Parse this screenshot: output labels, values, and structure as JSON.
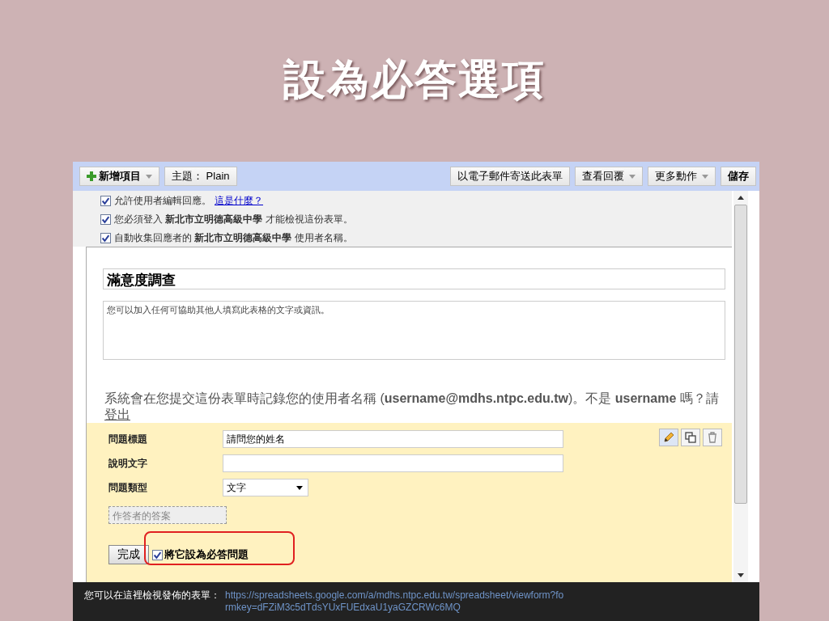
{
  "slide_title": "設為必答選項",
  "toolbar": {
    "left": [
      {
        "label": "新增項目",
        "kind": "add",
        "dropdown": true
      },
      {
        "label": "主題： Plain",
        "kind": "plain",
        "dropdown": false
      }
    ],
    "right": [
      {
        "label": "以電子郵件寄送此表單",
        "kind": "plain",
        "dropdown": false
      },
      {
        "label": "查看回覆",
        "kind": "plain",
        "dropdown": true
      },
      {
        "label": "更多動作",
        "kind": "plain",
        "dropdown": true
      },
      {
        "label": "儲存",
        "kind": "bold",
        "dropdown": false
      }
    ]
  },
  "settings": [
    {
      "checked": true,
      "text": "允許使用者編輯回應。",
      "link": "這是什麼？"
    },
    {
      "checked": true,
      "text": "您必須登入 **新北市立明德高級中學** 才能檢視這份表單。"
    },
    {
      "checked": true,
      "text": "自動收集回應者的 **新北市立明德高級中學** 使用者名稱。"
    }
  ],
  "form": {
    "title": "滿意度調查",
    "description": "您可以加入任何可協助其他人填寫此表格的文字或資訊。",
    "notice": "系統會在您提交這份表單時記錄您的使用者名稱 (**username@mdhs.ntpc.edu.tw**)。不是 **username** 嗎？請",
    "notice_link": "登出"
  },
  "question": {
    "fields": [
      {
        "label": "問題標題",
        "value": "請問您的姓名"
      },
      {
        "label": "說明文字"
      }
    ],
    "type_label": "問題類型",
    "type_value": "文字",
    "answer_placeholder": "作答者的答案",
    "done_button": "完成",
    "required": {
      "checked": true,
      "label": "將它設為必答問題",
      "highlighted": true
    }
  },
  "footer": {
    "label": "您可以在這裡檢視發佈的表單：",
    "link": "https://spreadsheets.google.com/a/mdhs.ntpc.edu.tw/spreadsheet/viewform?formkey=dFZiM3c5dTdsYUxFUEdxaU1yaGZCRWc6MQ"
  }
}
